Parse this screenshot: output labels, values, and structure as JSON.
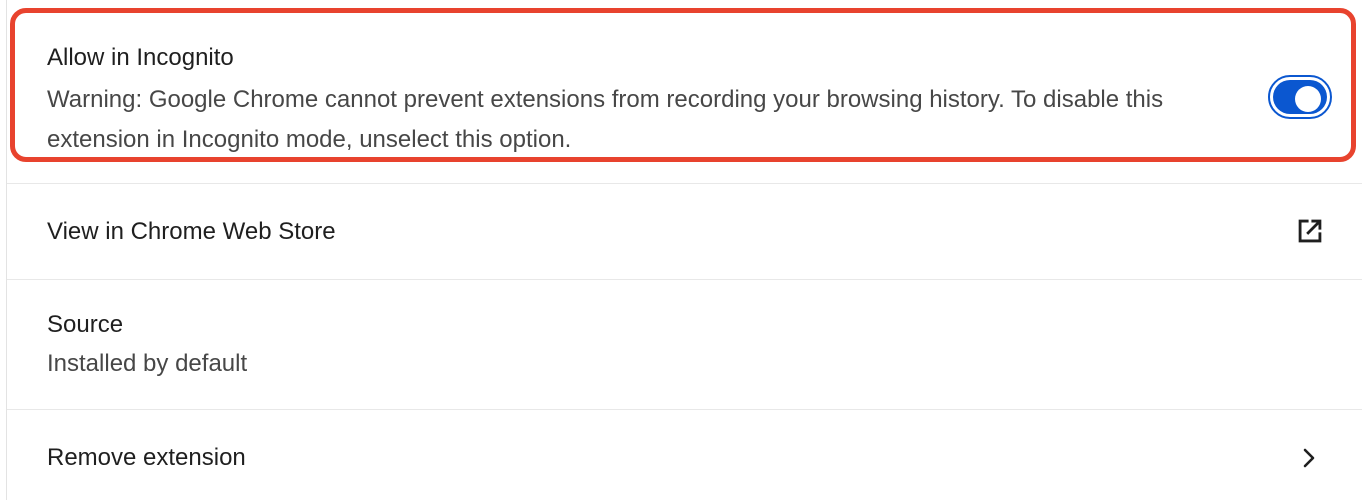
{
  "incognito": {
    "title": "Allow in Incognito",
    "description": "Warning: Google Chrome cannot prevent extensions from recording your browsing history. To disable this extension in Incognito mode, unselect this option.",
    "enabled": true,
    "toggle_color": "#0b57d0",
    "highlight_color": "#e8432e"
  },
  "webstore": {
    "label": "View in Chrome Web Store",
    "icon": "open-in-new-icon"
  },
  "source": {
    "title": "Source",
    "value": "Installed by default"
  },
  "remove": {
    "label": "Remove extension",
    "icon": "chevron-right-icon"
  }
}
